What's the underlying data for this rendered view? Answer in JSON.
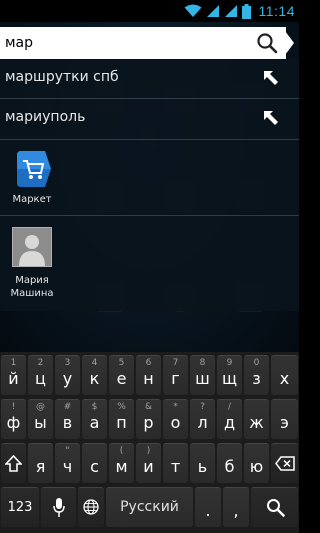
{
  "status_bar": {
    "time": "11:14",
    "icons": [
      "wifi-icon",
      "signal-icon",
      "signal-icon",
      "battery-icon"
    ]
  },
  "search": {
    "query": "мар",
    "icon": "search-icon"
  },
  "suggestions": [
    {
      "text": "маршрутки спб",
      "icon": "arrow-up-left-icon"
    },
    {
      "text": "мариуполь",
      "icon": "arrow-up-left-icon"
    }
  ],
  "results": {
    "app": {
      "label": "Маркет",
      "icon": "play-market-icon"
    },
    "contact": {
      "label_line1": "Мария",
      "label_line2": "Машина",
      "icon": "contact-avatar-icon"
    }
  },
  "keyboard": {
    "row1": [
      {
        "main": "й",
        "alt": "1"
      },
      {
        "main": "ц",
        "alt": "2"
      },
      {
        "main": "у",
        "alt": "3"
      },
      {
        "main": "к",
        "alt": "4"
      },
      {
        "main": "е",
        "alt": "5"
      },
      {
        "main": "н",
        "alt": "6"
      },
      {
        "main": "г",
        "alt": "7"
      },
      {
        "main": "ш",
        "alt": "8"
      },
      {
        "main": "щ",
        "alt": "9"
      },
      {
        "main": "з",
        "alt": "0"
      },
      {
        "main": "х",
        "alt": ""
      }
    ],
    "row2": [
      {
        "main": "ф",
        "alt": "!"
      },
      {
        "main": "ы",
        "alt": "@"
      },
      {
        "main": "в",
        "alt": "#"
      },
      {
        "main": "а",
        "alt": "$"
      },
      {
        "main": "п",
        "alt": "%"
      },
      {
        "main": "р",
        "alt": "&"
      },
      {
        "main": "о",
        "alt": "*"
      },
      {
        "main": "л",
        "alt": "?"
      },
      {
        "main": "д",
        "alt": "/"
      },
      {
        "main": "ж",
        "alt": ""
      },
      {
        "main": "э",
        "alt": ""
      }
    ],
    "row3": [
      {
        "main": "я",
        "alt": ""
      },
      {
        "main": "ч",
        "alt": "\""
      },
      {
        "main": "с",
        "alt": ""
      },
      {
        "main": "м",
        "alt": "("
      },
      {
        "main": "и",
        "alt": ")"
      },
      {
        "main": "т",
        "alt": ""
      },
      {
        "main": "ь",
        "alt": ""
      },
      {
        "main": "б",
        "alt": ""
      },
      {
        "main": "ю",
        "alt": ""
      }
    ],
    "row4": {
      "numbers_key": "123",
      "space_label": "Русский"
    },
    "colors": {
      "accent": "#33b5e5",
      "key_bg": "#2e2e2e",
      "alt_text": "#a0a0a0"
    }
  }
}
